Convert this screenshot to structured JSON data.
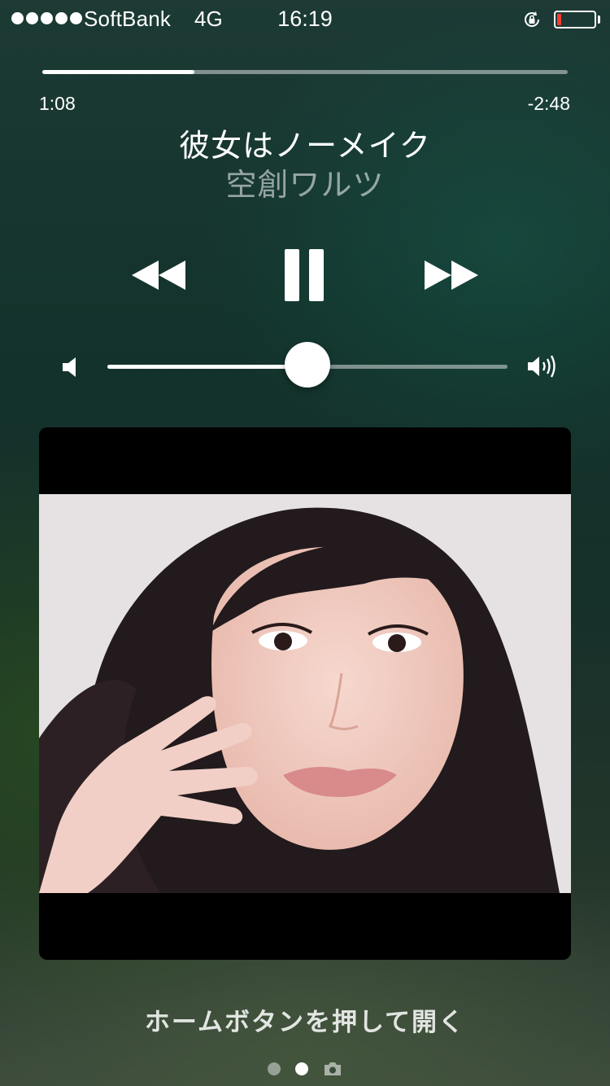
{
  "status_bar": {
    "signal_dots": 5,
    "carrier": "SoftBank",
    "network": "4G",
    "time": "16:19",
    "battery_color": "#ff3b30",
    "battery_level": 0.12
  },
  "playback": {
    "elapsed": "1:08",
    "remaining": "-2:48",
    "progress": 0.29
  },
  "track": {
    "title": "彼女はノーメイク",
    "artist": "空創ワルツ"
  },
  "controls": {
    "rewind_icon": "rewind-icon",
    "pause_icon": "pause-icon",
    "fast_forward_icon": "fast-forward-icon"
  },
  "volume": {
    "level": 0.5,
    "low_icon": "speaker-low-icon",
    "high_icon": "speaker-high-icon"
  },
  "lock_screen": {
    "unlock_hint": "ホームボタンを押して開く",
    "pages": [
      "dot",
      "dot-active",
      "camera"
    ]
  }
}
